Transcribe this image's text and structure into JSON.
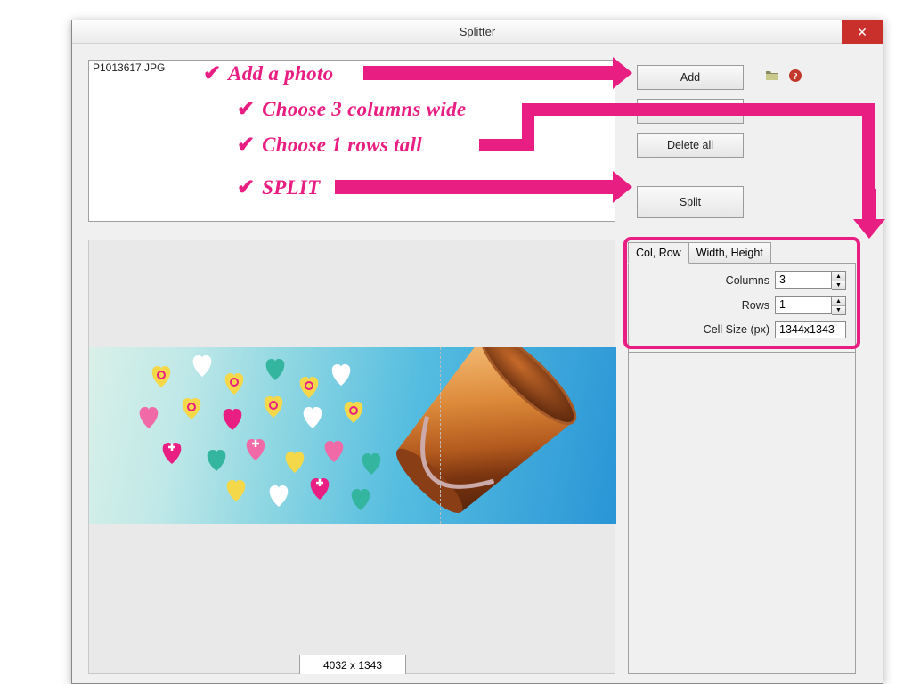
{
  "window": {
    "title": "Splitter"
  },
  "filelist": {
    "items": [
      "P1013617.JPG"
    ]
  },
  "buttons": {
    "add": "Add",
    "delete": "Delete",
    "delete_all": "Delete all",
    "split": "Split"
  },
  "tabs": {
    "colrow": "Col, Row",
    "wh": "Width, Height"
  },
  "fields": {
    "columns_label": "Columns",
    "columns_value": "3",
    "rows_label": "Rows",
    "rows_value": "1",
    "cellsize_label": "Cell Size (px)",
    "cellsize_value": "1344x1343"
  },
  "preview": {
    "dimensions": "4032 x 1343"
  },
  "annotations": {
    "step1": "Add a photo",
    "step2": "Choose 3 columns wide",
    "step3": "Choose 1 rows tall",
    "step4": "SPLIT"
  },
  "colors": {
    "accent": "#e91e82",
    "close": "#c9302c"
  }
}
